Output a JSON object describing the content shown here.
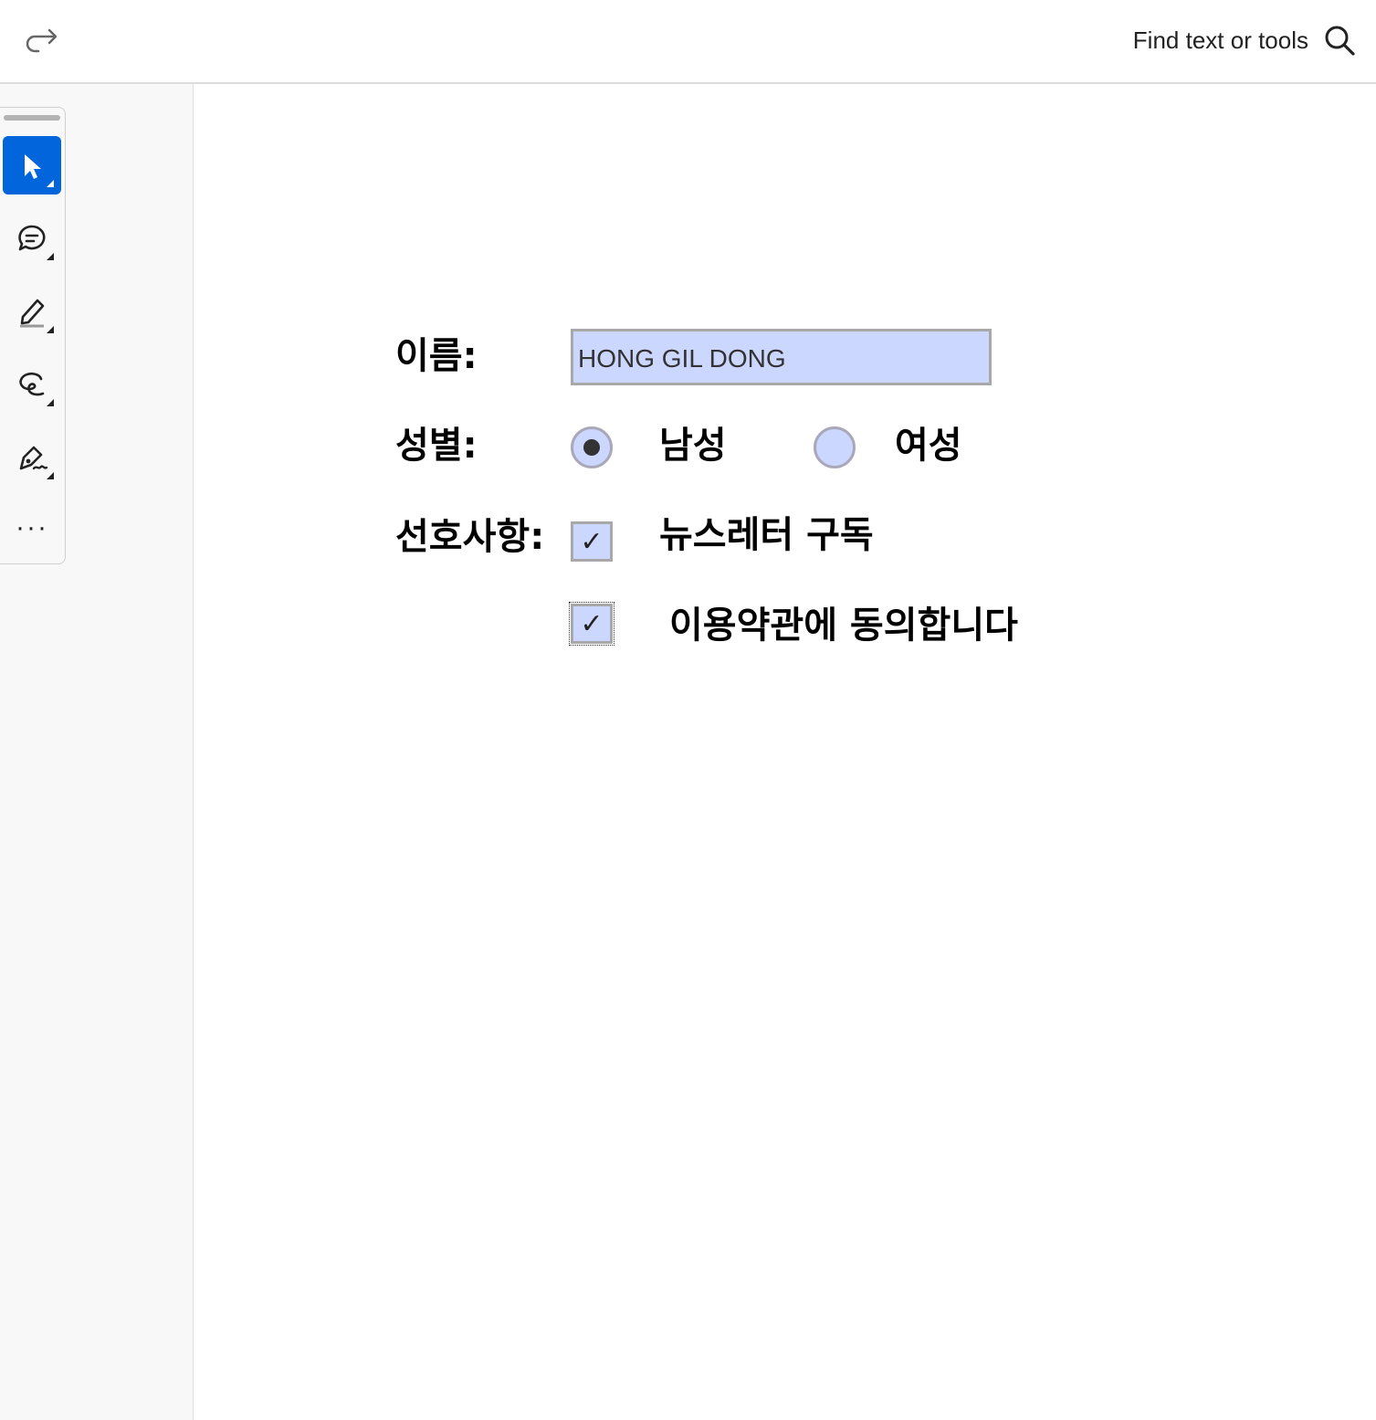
{
  "topbar": {
    "search_label": "Find text or tools",
    "icons": [
      "redo-icon",
      "search-icon"
    ]
  },
  "toolbar": {
    "tools": [
      {
        "name": "select-tool",
        "icon": "cursor-arrow-icon",
        "active": true
      },
      {
        "name": "comment-tool",
        "icon": "comment-bubble-icon",
        "active": false
      },
      {
        "name": "highlight-tool",
        "icon": "highlighter-pen-icon",
        "active": false
      },
      {
        "name": "draw-tool",
        "icon": "freehand-draw-icon",
        "active": false
      },
      {
        "name": "sign-tool",
        "icon": "pen-sign-icon",
        "active": false
      }
    ],
    "more_label": "···"
  },
  "form": {
    "name_label": "이름:",
    "name_value": "HONG GIL DONG",
    "gender_label": "성별:",
    "gender_male_label": "남성",
    "gender_female_label": "여성",
    "gender_selected": "남성",
    "preferences_label": "선호사항:",
    "newsletter_label": "뉴스레터 구독",
    "newsletter_checked": true,
    "terms_label": "이용약관에 동의합니다",
    "terms_checked": true,
    "check_mark": "✓"
  },
  "colors": {
    "field_fill": "#ccd7ff",
    "active_tool": "#0265dc",
    "panel_bg": "#f8f8f8"
  }
}
